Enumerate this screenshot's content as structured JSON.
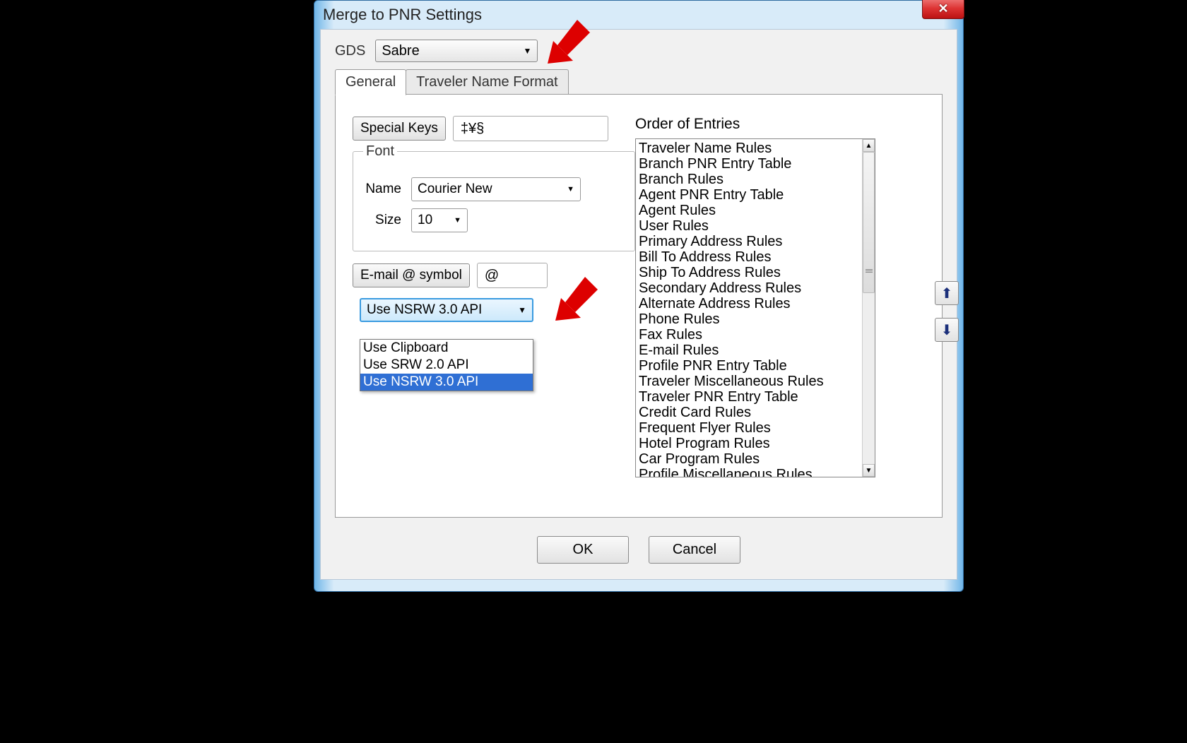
{
  "dialog": {
    "title": "Merge to PNR Settings"
  },
  "gds": {
    "label": "GDS",
    "selected": "Sabre"
  },
  "tabs": {
    "general": "General",
    "traveler_name_format": "Traveler Name Format"
  },
  "special_keys": {
    "button": "Special Keys",
    "value": "‡¥§"
  },
  "font_group": {
    "legend": "Font",
    "name_label": "Name",
    "name_value": "Courier New",
    "size_label": "Size",
    "size_value": "10"
  },
  "email_symbol": {
    "button": "E-mail @ symbol",
    "value": "@"
  },
  "api_selector": {
    "selected": "Use NSRW 3.0 API",
    "options": [
      "Use Clipboard",
      "Use SRW 2.0 API",
      "Use NSRW 3.0 API"
    ],
    "highlighted_index": 2
  },
  "order_of_entries": {
    "label": "Order of Entries",
    "items": [
      "Traveler Name Rules",
      "Branch PNR Entry Table",
      "Branch Rules",
      "Agent PNR Entry Table",
      "Agent Rules",
      "User Rules",
      "Primary Address Rules",
      "Bill To Address Rules",
      "Ship To Address Rules",
      "Secondary Address Rules",
      "Alternate Address Rules",
      "Phone Rules",
      "Fax Rules",
      "E-mail Rules",
      "Profile PNR Entry Table",
      "Traveler Miscellaneous Rules",
      "Traveler PNR Entry Table",
      "Credit Card Rules",
      "Frequent Flyer Rules",
      "Hotel Program Rules",
      "Car Program Rules",
      "Profile Miscellaneous Rules"
    ]
  },
  "buttons": {
    "ok": "OK",
    "cancel": "Cancel"
  }
}
